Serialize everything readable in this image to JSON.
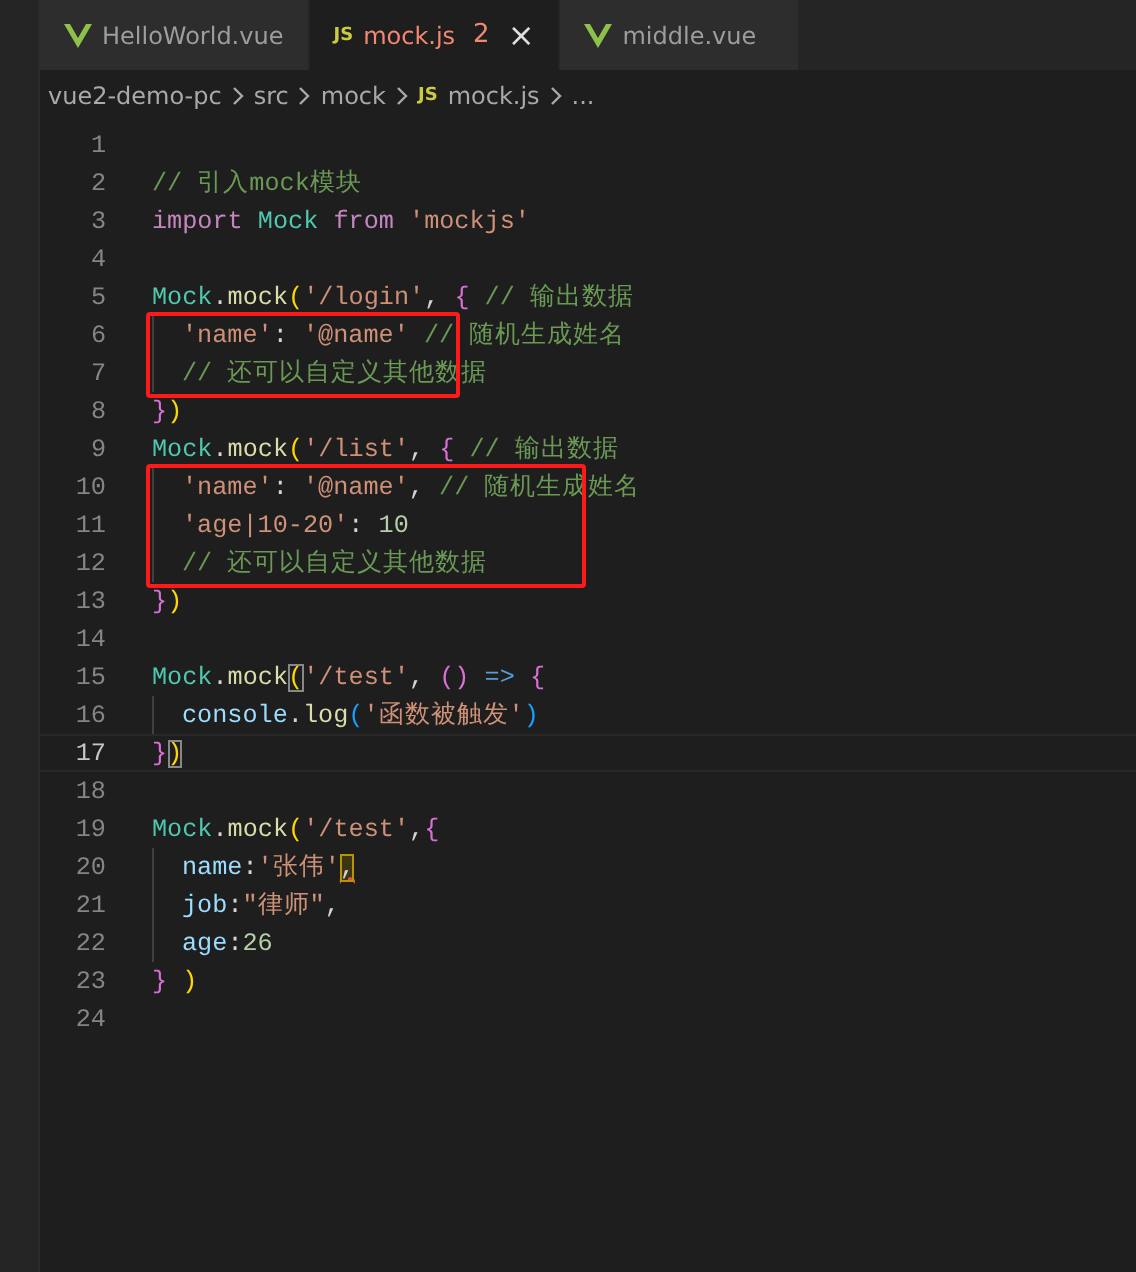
{
  "tabs": [
    {
      "label": "HelloWorld.vue",
      "kind": "vue",
      "selected": false,
      "error": false
    },
    {
      "label": "mock.js",
      "kind": "js",
      "icon_text": "JS",
      "selected": true,
      "error": true,
      "badge": "2",
      "close": "×"
    },
    {
      "label": "middle.vue",
      "kind": "vue",
      "selected": false,
      "error": false
    }
  ],
  "breadcrumb": [
    {
      "label": "vue2-demo-pc"
    },
    {
      "label": "src"
    },
    {
      "label": "mock"
    },
    {
      "label": "mock.js",
      "icon_text": "JS"
    },
    {
      "label": "..."
    }
  ],
  "code": [
    {
      "kind": "line",
      "number": "1",
      "current": false
    },
    {
      "kind": "line",
      "number": "2",
      "current": false,
      "tokens": [
        {
          "kind": "comment",
          "text": "// 引入mock模块"
        }
      ]
    },
    {
      "kind": "line",
      "number": "3",
      "current": false,
      "tokens": [
        {
          "kind": "keyword",
          "text": "import"
        },
        {
          "kind": "class",
          "text": " Mock"
        },
        {
          "kind": "keyword",
          "text": " from"
        },
        {
          "kind": "string",
          "text": " 'mockjs'"
        }
      ]
    },
    {
      "kind": "line",
      "number": "4",
      "current": false
    },
    {
      "kind": "line",
      "number": "5",
      "current": false,
      "tokens": [
        {
          "kind": "class",
          "text": "Mock"
        },
        {
          "kind": "plain",
          "text": "."
        },
        {
          "kind": "func",
          "text": "mock"
        },
        {
          "kind": "bracket1",
          "text": "("
        },
        {
          "kind": "string",
          "text": "'/login'"
        },
        {
          "kind": "plain",
          "text": ", "
        },
        {
          "kind": "bracket2",
          "text": "{"
        },
        {
          "kind": "comment",
          "text": " // 输出数据"
        }
      ]
    },
    {
      "kind": "boxed",
      "lines": [
        {
          "kind": "line",
          "number": "6",
          "current": false,
          "indented": true,
          "tokens": [
            {
              "kind": "string",
              "text": "'name'"
            },
            {
              "kind": "plain",
              "text": ": "
            },
            {
              "kind": "string",
              "text": "'@name'"
            },
            {
              "kind": "comment",
              "text": " // 随机生成姓名"
            }
          ]
        },
        {
          "kind": "line",
          "number": "7",
          "current": false,
          "indented": true,
          "tokens": [
            {
              "kind": "comment",
              "text": "// 还可以自定义其他数据"
            }
          ]
        }
      ]
    },
    {
      "kind": "line",
      "number": "8",
      "current": false,
      "tokens": [
        {
          "kind": "bracket2",
          "text": "}"
        },
        {
          "kind": "bracket1",
          "text": ")"
        }
      ]
    },
    {
      "kind": "line",
      "number": "9",
      "current": false,
      "tokens": [
        {
          "kind": "class",
          "text": "Mock"
        },
        {
          "kind": "plain",
          "text": "."
        },
        {
          "kind": "func",
          "text": "mock"
        },
        {
          "kind": "bracket1",
          "text": "("
        },
        {
          "kind": "string",
          "text": "'/list'"
        },
        {
          "kind": "plain",
          "text": ", "
        },
        {
          "kind": "bracket2",
          "text": "{"
        },
        {
          "kind": "comment",
          "text": " // 输出数据"
        }
      ]
    },
    {
      "kind": "boxed",
      "lines": [
        {
          "kind": "line",
          "number": "10",
          "current": false,
          "indented": true,
          "tokens": [
            {
              "kind": "string",
              "text": "'name'"
            },
            {
              "kind": "plain",
              "text": ": "
            },
            {
              "kind": "string",
              "text": "'@name'"
            },
            {
              "kind": "plain",
              "text": ", "
            },
            {
              "kind": "comment",
              "text": "// 随机生成姓名"
            }
          ]
        },
        {
          "kind": "line",
          "number": "11",
          "current": false,
          "indented": true,
          "tokens": [
            {
              "kind": "string",
              "text": "'age|10-20'"
            },
            {
              "kind": "plain",
              "text": ": "
            },
            {
              "kind": "number",
              "text": "10"
            }
          ]
        },
        {
          "kind": "line",
          "number": "12",
          "current": false,
          "indented": true,
          "tokens": [
            {
              "kind": "comment",
              "text": "// 还可以自定义其他数据"
            }
          ]
        }
      ]
    },
    {
      "kind": "line",
      "number": "13",
      "current": false,
      "tokens": [
        {
          "kind": "bracket2",
          "text": "}"
        },
        {
          "kind": "bracket1",
          "text": ")"
        }
      ]
    },
    {
      "kind": "line",
      "number": "14",
      "current": false
    },
    {
      "kind": "line",
      "number": "15",
      "current": false,
      "tokens": [
        {
          "kind": "class",
          "text": "Mock"
        },
        {
          "kind": "plain",
          "text": "."
        },
        {
          "kind": "func",
          "text": "mock"
        },
        {
          "kind": "bracket1",
          "text": "(",
          "boxed": true
        },
        {
          "kind": "string",
          "text": "'/test'"
        },
        {
          "kind": "plain",
          "text": ", "
        },
        {
          "kind": "bracket2",
          "text": "()"
        },
        {
          "kind": "keyword2",
          "text": " =>"
        },
        {
          "kind": "bracket2",
          "text": " {"
        }
      ]
    },
    {
      "kind": "line",
      "number": "16",
      "current": false,
      "indented": true,
      "tokens": [
        {
          "kind": "prop",
          "text": "console"
        },
        {
          "kind": "plain",
          "text": "."
        },
        {
          "kind": "func",
          "text": "log"
        },
        {
          "kind": "bracket3",
          "text": "("
        },
        {
          "kind": "string",
          "text": "'函数被触发'"
        },
        {
          "kind": "bracket3",
          "text": ")"
        }
      ]
    },
    {
      "kind": "line",
      "number": "17",
      "current": true,
      "tokens": [
        {
          "kind": "bracket2",
          "text": "}"
        },
        {
          "kind": "bracket1",
          "text": ")",
          "boxed": true
        }
      ]
    },
    {
      "kind": "line",
      "number": "18",
      "current": false
    },
    {
      "kind": "line",
      "number": "19",
      "current": false,
      "tokens": [
        {
          "kind": "class",
          "text": "Mock"
        },
        {
          "kind": "plain",
          "text": "."
        },
        {
          "kind": "func",
          "text": "mock"
        },
        {
          "kind": "bracket1",
          "text": "("
        },
        {
          "kind": "string",
          "text": "'/test'"
        },
        {
          "kind": "plain",
          "text": ","
        },
        {
          "kind": "bracket2",
          "text": "{"
        }
      ]
    },
    {
      "kind": "line",
      "number": "20",
      "current": false,
      "indented": true,
      "tokens": [
        {
          "kind": "prop",
          "text": "name"
        },
        {
          "kind": "plain",
          "text": ":"
        },
        {
          "kind": "string",
          "text": "'张伟'"
        },
        {
          "kind": "plain",
          "text": ",",
          "boxed": true,
          "error": true
        }
      ]
    },
    {
      "kind": "line",
      "number": "21",
      "current": false,
      "indented": true,
      "tokens": [
        {
          "kind": "prop",
          "text": "job"
        },
        {
          "kind": "plain",
          "text": ":"
        },
        {
          "kind": "string",
          "text": "\"律师\""
        },
        {
          "kind": "plain",
          "text": ","
        }
      ]
    },
    {
      "kind": "line",
      "number": "22",
      "current": false,
      "indented": true,
      "tokens": [
        {
          "kind": "prop",
          "text": "age"
        },
        {
          "kind": "plain",
          "text": ":"
        },
        {
          "kind": "number",
          "text": "26"
        }
      ]
    },
    {
      "kind": "line",
      "number": "23",
      "current": false,
      "tokens": [
        {
          "kind": "bracket2",
          "text": "}"
        },
        {
          "kind": "bracket1",
          "text": " )"
        }
      ]
    },
    {
      "kind": "line",
      "number": "24",
      "current": false
    }
  ]
}
